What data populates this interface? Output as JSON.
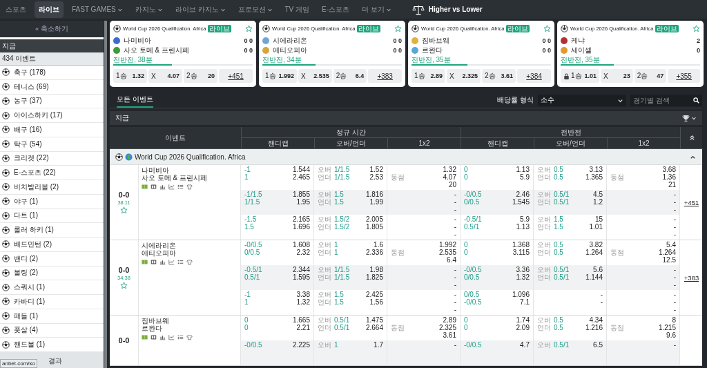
{
  "nav": {
    "items": [
      {
        "label": "스포츠",
        "selected": false,
        "dropdown": false
      },
      {
        "label": "라이브",
        "selected": true,
        "dropdown": false
      },
      {
        "label": "FAST GAMES",
        "selected": false,
        "dropdown": true
      },
      {
        "label": "카지노",
        "selected": false,
        "dropdown": true
      },
      {
        "label": "라이브 카지노",
        "selected": false,
        "dropdown": true
      },
      {
        "label": "프로모션",
        "selected": false,
        "dropdown": true
      },
      {
        "label": "TV 게임",
        "selected": false,
        "dropdown": false
      },
      {
        "label": "E-스포츠",
        "selected": false,
        "dropdown": false
      },
      {
        "label": "더 보기",
        "selected": false,
        "dropdown": true
      }
    ],
    "promo": "Higher vs Lower"
  },
  "sidebar": {
    "collapse": "« 축소하기",
    "now": "지금",
    "event_count": "434 이벤트",
    "sports": [
      "축구 (178)",
      "테니스 (69)",
      "농구 (37)",
      "아이스하키 (17)",
      "배구 (16)",
      "탁구 (54)",
      "크리켓 (22)",
      "E-스포츠 (22)",
      "비치발리볼 (2)",
      "야구 (1)",
      "다트 (1)",
      "롤러 하키 (1)",
      "배드민턴 (2)",
      "밴디 (2)",
      "볼링 (2)",
      "스쿼시 (1)",
      "카바디 (1)",
      "패들 (1)",
      "풋살 (4)",
      "핸드볼 (1)"
    ],
    "results": "결과"
  },
  "status_url": "anbet.com/ko",
  "cards": [
    {
      "league": "World Cup 2026 Qualification. Africa",
      "badge": "라이브",
      "home": {
        "name": "나미비아",
        "score": "0 0",
        "color": "#3b6fc6"
      },
      "away": {
        "name": "사오 토메 & 프린시페",
        "score": "0 0",
        "color": "#3f9b3a"
      },
      "period": "전반전, 38분",
      "progress": {
        "level": 0.42
      },
      "odds": [
        {
          "label": "1승",
          "value": "1.32",
          "locked": false
        },
        {
          "label": "X",
          "value": "4.07",
          "locked": false
        },
        {
          "label": "2승",
          "value": "20",
          "locked": false
        }
      ],
      "more": "+451"
    },
    {
      "league": "World Cup 2026 Qualification. Africa",
      "badge": "라이브",
      "home": {
        "name": "시에라리온",
        "score": "0 0",
        "color": "#6fa6d8"
      },
      "away": {
        "name": "에티오피아",
        "score": "0 0",
        "color": "#d8a53a"
      },
      "period": "전반전, 34분",
      "progress": {
        "level": 0.38
      },
      "odds": [
        {
          "label": "1승",
          "value": "1.992",
          "locked": false
        },
        {
          "label": "X",
          "value": "2.535",
          "locked": false
        },
        {
          "label": "2승",
          "value": "6.4",
          "locked": false
        }
      ],
      "more": "+383"
    },
    {
      "league": "World Cup 2026 Qualification. Africa",
      "badge": "라이브",
      "home": {
        "name": "짐바브웨",
        "score": "0 0",
        "color": "#e0b040"
      },
      "away": {
        "name": "르완다",
        "score": "0 0",
        "color": "#5aa8d8"
      },
      "period": "전반전, 35분",
      "progress": {
        "level": 0.4
      },
      "odds": [
        {
          "label": "1승",
          "value": "2.89",
          "locked": false
        },
        {
          "label": "X",
          "value": "2.325",
          "locked": false
        },
        {
          "label": "2승",
          "value": "3.61",
          "locked": false
        }
      ],
      "more": "+384"
    },
    {
      "league": "World Cup 2026 Qualification. Africa",
      "badge": "라이브",
      "home": {
        "name": "케냐",
        "score": "2",
        "color": "#b03232"
      },
      "away": {
        "name": "세이셸",
        "score": "0",
        "color": "#e09a30"
      },
      "period": "전반전, 35분",
      "progress": {
        "level": 0.38
      },
      "odds": [
        {
          "label": "1승",
          "value": "1.01",
          "locked": true
        },
        {
          "label": "X",
          "value": "23",
          "locked": false
        },
        {
          "label": "2승",
          "value": "47",
          "locked": false
        }
      ],
      "more": "+355"
    }
  ],
  "filters": {
    "tabs": [
      {
        "label": "모든 이벤트",
        "selected": true
      }
    ],
    "odds_format_label": "배당률 형식",
    "odds_format": "소수",
    "search": {
      "placeholder": "경기별 검색"
    }
  },
  "section": {
    "title": "지금"
  },
  "table": {
    "event_header": "이벤트",
    "groups": [
      {
        "title": "정규 시간",
        "columns": [
          "핸디캡",
          "오버/언더",
          "1x2"
        ]
      },
      {
        "title": "전반전",
        "columns": [
          "핸디캡",
          "오버/언더",
          "1x2"
        ]
      }
    ],
    "league": {
      "name": "World Cup 2026 Qualification. Africa",
      "expanded": true
    },
    "matches": [
      {
        "home": "나미비아",
        "away": "사오 토메 & 프린시페",
        "score": "0-0",
        "time": "38:11",
        "more": "+451",
        "rows": [
          [
            [
              {
                "line": "-1",
                "odd": "1.544"
              },
              {
                "line": "1",
                "odd": "2.465"
              }
            ],
            [
              {
                "side": "오버",
                "line": "1/1.5",
                "odd": "1.52"
              },
              {
                "side": "언더",
                "line": "1/1.5",
                "odd": "2.53"
              }
            ],
            [
              {
                "odd": "1.32"
              },
              {
                "side": "동점",
                "odd": "4.07"
              },
              {
                "odd": "20"
              }
            ],
            [
              {
                "line": "0",
                "odd": "1.13"
              },
              {
                "line": "0",
                "odd": "5.9"
              }
            ],
            [
              {
                "side": "오버",
                "line": "0.5",
                "odd": "3.13"
              },
              {
                "side": "언더",
                "line": "0.5",
                "odd": "1.365"
              }
            ],
            [
              {
                "odd": "3.68"
              },
              {
                "side": "동점",
                "odd": "1.36"
              },
              {
                "odd": "21"
              }
            ]
          ],
          [
            [
              {
                "line": "-1/1.5",
                "odd": "1.855"
              },
              {
                "line": "1/1.5",
                "odd": "1.95"
              }
            ],
            [
              {
                "side": "오버",
                "line": "1.5",
                "odd": "1.816"
              },
              {
                "side": "언더",
                "line": "1.5",
                "odd": "1.99"
              }
            ],
            [
              {
                "odd": "-"
              },
              {
                "odd": "-"
              },
              {
                "odd": "-"
              }
            ],
            [
              {
                "line": "-0/0.5",
                "odd": "2.46"
              },
              {
                "line": "0/0.5",
                "odd": "1.545"
              }
            ],
            [
              {
                "side": "오버",
                "line": "0.5/1",
                "odd": "4.5"
              },
              {
                "side": "언더",
                "line": "0.5/1",
                "odd": "1.2"
              }
            ],
            [
              {
                "odd": "-"
              },
              {
                "odd": "-"
              },
              {
                "odd": "-"
              }
            ]
          ],
          [
            [
              {
                "line": "-1.5",
                "odd": "2.165"
              },
              {
                "line": "1.5",
                "odd": "1.696"
              }
            ],
            [
              {
                "side": "오버",
                "line": "1.5/2",
                "odd": "2.005"
              },
              {
                "side": "언더",
                "line": "1.5/2",
                "odd": "1.805"
              }
            ],
            [
              {
                "odd": "-"
              },
              {
                "odd": "-"
              },
              {
                "odd": "-"
              }
            ],
            [
              {
                "line": "-0.5/1",
                "odd": "5.9"
              },
              {
                "line": "0.5/1",
                "odd": "1.13"
              }
            ],
            [
              {
                "side": "오버",
                "line": "1.5",
                "odd": "15"
              },
              {
                "side": "언더",
                "line": "1.5",
                "odd": "1.01"
              }
            ],
            [
              {
                "odd": "-"
              },
              {
                "odd": "-"
              },
              {
                "odd": "-"
              }
            ]
          ]
        ]
      },
      {
        "home": "시에라리온",
        "away": "에티오피아",
        "score": "0-0",
        "time": "34:38",
        "more": "+383",
        "rows": [
          [
            [
              {
                "line": "-0/0.5",
                "odd": "1.608"
              },
              {
                "line": "0/0.5",
                "odd": "2.32"
              }
            ],
            [
              {
                "side": "오버",
                "line": "1",
                "odd": "1.6"
              },
              {
                "side": "언더",
                "line": "1",
                "odd": "2.336"
              }
            ],
            [
              {
                "odd": "1.992"
              },
              {
                "side": "동점",
                "odd": "2.535"
              },
              {
                "odd": "6.4"
              }
            ],
            [
              {
                "line": "0",
                "odd": "1.368"
              },
              {
                "line": "0",
                "odd": "3.115"
              }
            ],
            [
              {
                "side": "오버",
                "line": "0.5",
                "odd": "3.82"
              },
              {
                "side": "언더",
                "line": "0.5",
                "odd": "1.264"
              }
            ],
            [
              {
                "odd": "5.4"
              },
              {
                "side": "동점",
                "odd": "1.264"
              },
              {
                "odd": "12.5"
              }
            ]
          ],
          [
            [
              {
                "line": "-0.5/1",
                "odd": "2.344"
              },
              {
                "line": "0.5/1",
                "odd": "1.595"
              }
            ],
            [
              {
                "side": "오버",
                "line": "1/1.5",
                "odd": "1.98"
              },
              {
                "side": "언더",
                "line": "1/1.5",
                "odd": "1.825"
              }
            ],
            [
              {
                "odd": "-"
              },
              {
                "odd": "-"
              },
              {
                "odd": "-"
              }
            ],
            [
              {
                "line": "-0/0.5",
                "odd": "3.36"
              },
              {
                "line": "0/0.5",
                "odd": "1.32"
              }
            ],
            [
              {
                "side": "오버",
                "line": "0.5/1",
                "odd": "5.6"
              },
              {
                "side": "언더",
                "line": "0.5/1",
                "odd": "1.144"
              }
            ],
            [
              {
                "odd": "-"
              },
              {
                "odd": "-"
              },
              {
                "odd": "-"
              }
            ]
          ],
          [
            [
              {
                "line": "-1",
                "odd": "3.38"
              },
              {
                "line": "1",
                "odd": "1.32"
              }
            ],
            [
              {
                "side": "오버",
                "line": "1.5",
                "odd": "2.425"
              },
              {
                "side": "언더",
                "line": "1.5",
                "odd": "1.56"
              }
            ],
            [
              {
                "odd": "-"
              },
              {
                "odd": "-"
              },
              {
                "odd": "-"
              }
            ],
            [
              {
                "line": "0/0.5",
                "odd": "1.096"
              },
              {
                "line": "-0/0.5",
                "odd": "7.1"
              }
            ],
            [
              {
                "odd": "-"
              },
              {
                "odd": "-"
              }
            ],
            [
              {
                "odd": "-"
              },
              {
                "odd": "-"
              },
              {
                "odd": "-"
              }
            ]
          ]
        ]
      },
      {
        "home": "짐바브웨",
        "away": "르완다",
        "score": "0-0",
        "rows": [
          [
            [
              {
                "line": "0",
                "odd": "1.665"
              },
              {
                "line": "0",
                "odd": "2.21"
              }
            ],
            [
              {
                "side": "오버",
                "line": "0.5/1",
                "odd": "1.475"
              },
              {
                "side": "언더",
                "line": "0.5/1",
                "odd": "2.664"
              }
            ],
            [
              {
                "odd": "2.89"
              },
              {
                "side": "동점",
                "odd": "2.325"
              },
              {
                "odd": "3.61"
              }
            ],
            [
              {
                "line": "0",
                "odd": "1.74"
              },
              {
                "line": "0",
                "odd": "2.09"
              }
            ],
            [
              {
                "side": "오버",
                "line": "0.5",
                "odd": "4.34"
              },
              {
                "side": "언더",
                "line": "0.5",
                "odd": "1.216"
              }
            ],
            [
              {
                "odd": "8"
              },
              {
                "side": "동점",
                "odd": "1.215"
              },
              {
                "odd": "9.6"
              }
            ]
          ],
          [
            [
              {
                "line": "-0/0.5",
                "odd": "2.225"
              }
            ],
            [
              {
                "side": "오버",
                "line": "1",
                "odd": "1.7"
              }
            ],
            [
              {
                "odd": "-"
              }
            ],
            [
              {
                "line": "-0/0.5",
                "odd": "4.7"
              }
            ],
            [
              {
                "side": "오버",
                "line": "0.5/1",
                "odd": "6.5"
              }
            ],
            [
              {
                "odd": "-"
              }
            ]
          ]
        ]
      }
    ]
  }
}
